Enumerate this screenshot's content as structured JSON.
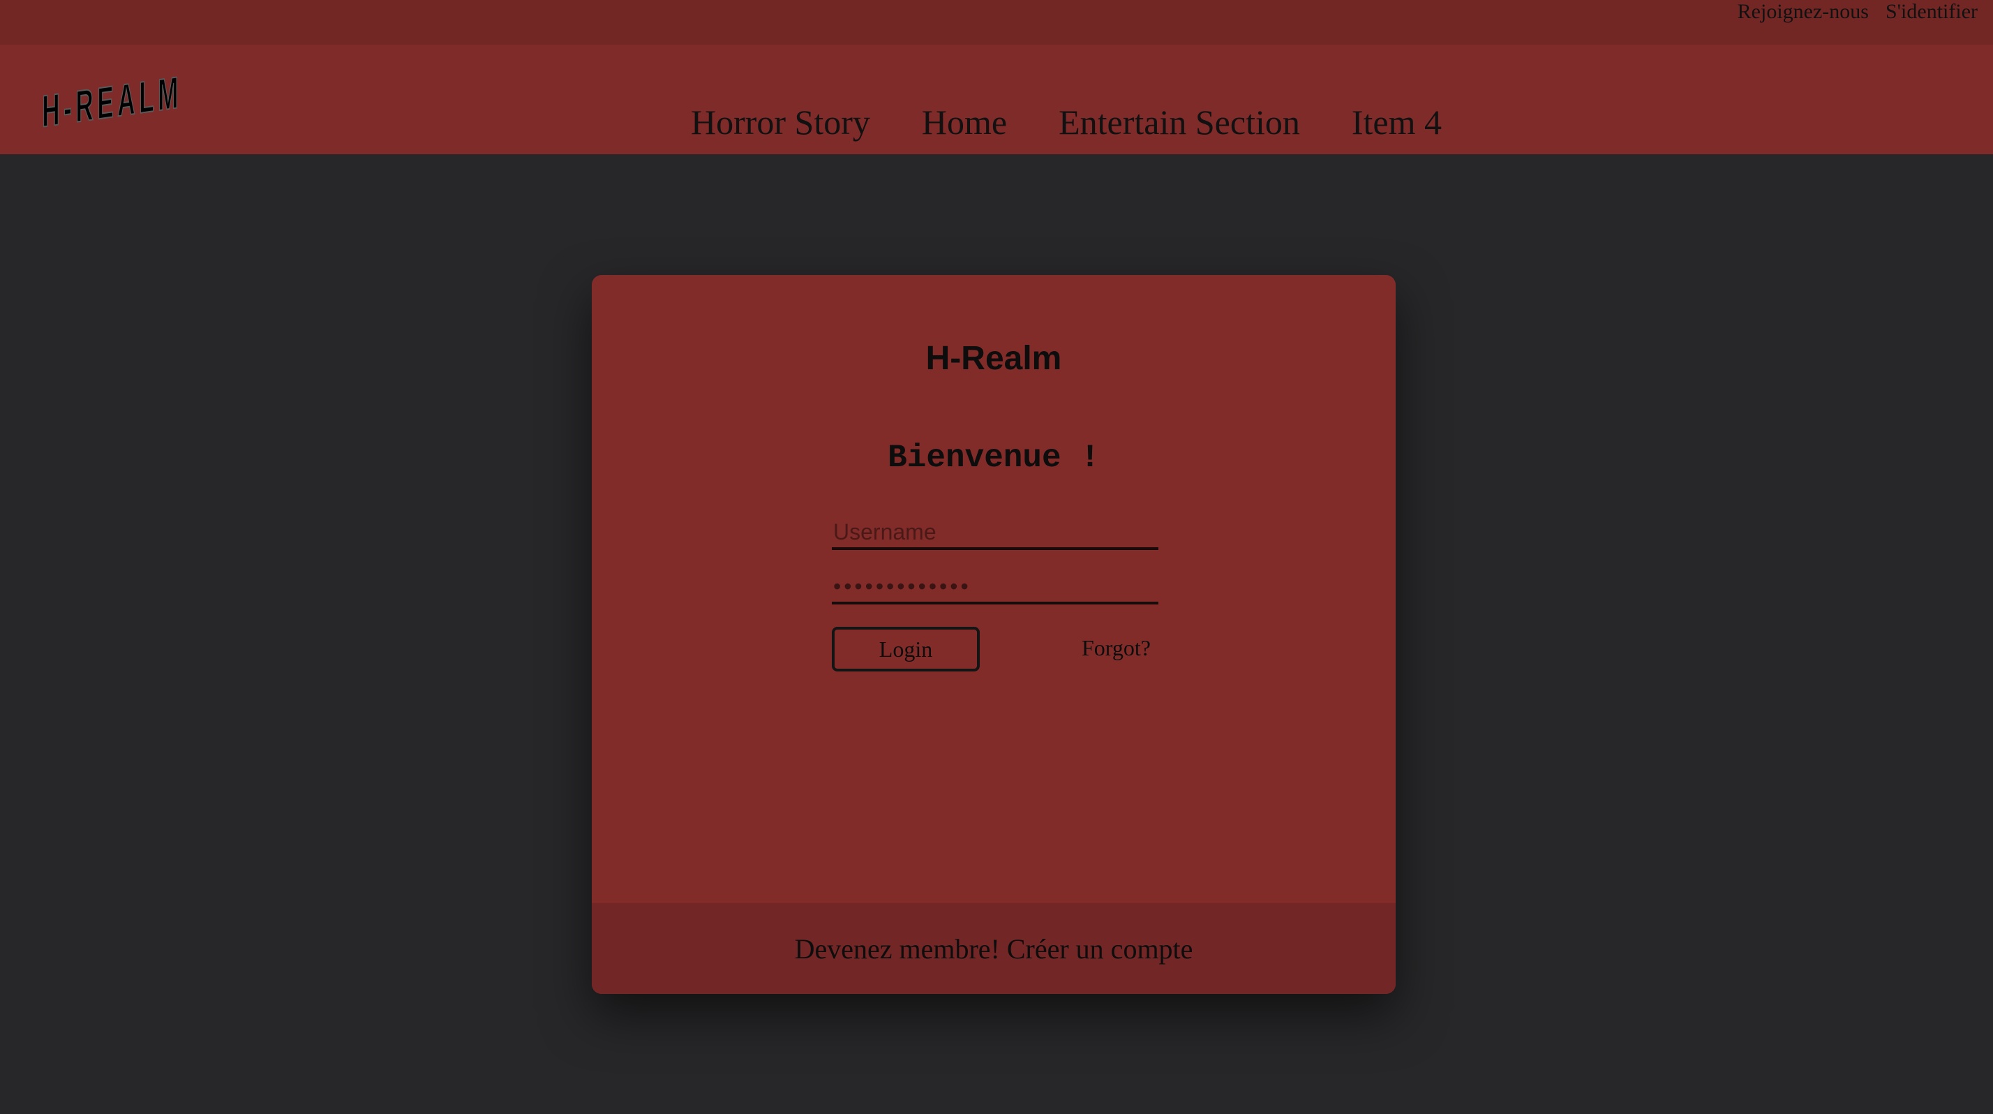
{
  "top_links": {
    "join": "Rejoignez-nous",
    "signin": "S'identifier"
  },
  "logo": {
    "text": "H-REALM",
    "icon": "h-realm-logo"
  },
  "nav": {
    "items": [
      {
        "label": "Horror Story"
      },
      {
        "label": "Home"
      },
      {
        "label": "Entertain Section"
      },
      {
        "label": "Item 4"
      }
    ]
  },
  "login_card": {
    "brand": "H-Realm",
    "welcome": "Bienvenue !",
    "username_placeholder": "Username",
    "password_value": "•••••••••••••",
    "login_label": "Login",
    "forgot_label": "Forgot?",
    "footer_text": "Devenez membre! Créer un compte"
  },
  "colors": {
    "page_background": "#272729",
    "top_strip": "#722725",
    "navbar": "#7e2b29",
    "card": "#822c2a",
    "card_footer": "#722625",
    "text": "#111111"
  }
}
